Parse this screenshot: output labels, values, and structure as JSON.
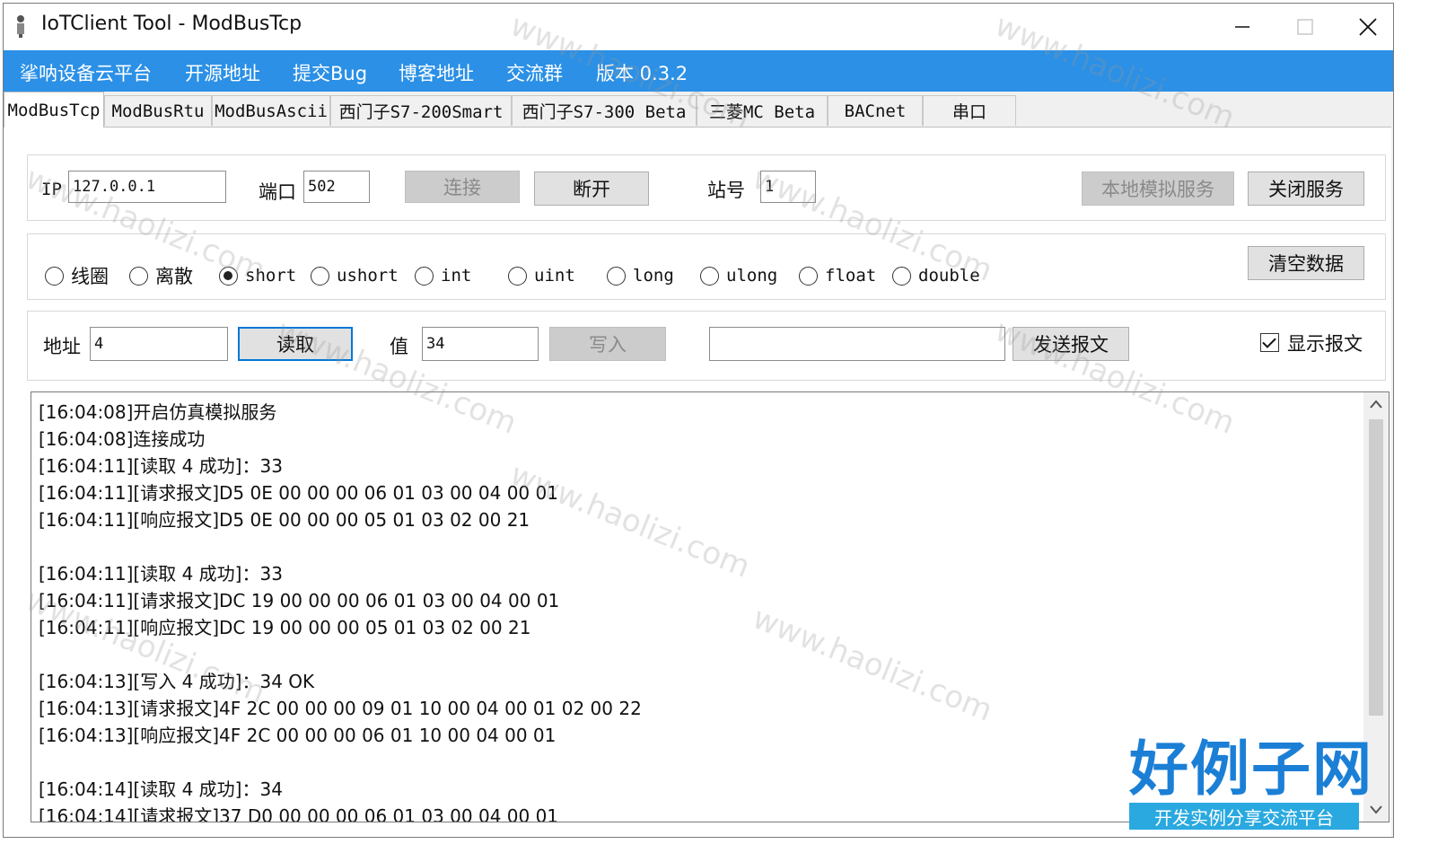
{
  "window": {
    "title": "IoTClient Tool - ModBusTcp"
  },
  "menu": [
    {
      "label": "挲呐设备云平台"
    },
    {
      "label": "开源地址"
    },
    {
      "label": "提交Bug"
    },
    {
      "label": "博客地址"
    },
    {
      "label": "交流群"
    },
    {
      "label": "版本 0.3.2"
    }
  ],
  "tabs": [
    {
      "label": "ModBusTcp"
    },
    {
      "label": "ModBusRtu"
    },
    {
      "label": "ModBusAscii"
    },
    {
      "label": "西门子S7-200Smart"
    },
    {
      "label": "西门子S7-300 Beta"
    },
    {
      "label": "三菱MC Beta"
    },
    {
      "label": "BACnet"
    },
    {
      "label": "串口"
    }
  ],
  "connection": {
    "ip_label": "IP",
    "ip_value": "127.0.0.1",
    "port_label": "端口",
    "port_value": "502",
    "connect_label": "连接",
    "disconnect_label": "断开",
    "station_label": "站号",
    "station_value": "1",
    "local_sim_label": "本地模拟服务",
    "close_service_label": "关闭服务"
  },
  "datatypes": {
    "options": [
      "线圈",
      "离散",
      "short",
      "ushort",
      "int",
      "uint",
      "long",
      "ulong",
      "float",
      "double"
    ],
    "selected": "short",
    "clear_label": "清空数据"
  },
  "io": {
    "address_label": "地址",
    "address_value": "4",
    "read_label": "读取",
    "value_label": "值",
    "value_value": "34",
    "write_label": "写入",
    "message_value": "",
    "send_label": "发送报文",
    "show_message_label": "显示报文",
    "show_message_checked": true
  },
  "log": [
    "[16:04:08]开启仿真模拟服务",
    "[16:04:08]连接成功",
    "[16:04:11][读取 4 成功]：33",
    "[16:04:11][请求报文]D5 0E 00 00 00 06 01 03 00 04 00 01",
    "[16:04:11][响应报文]D5 0E 00 00 00 05 01 03 02 00 21",
    "",
    "[16:04:11][读取 4 成功]：33",
    "[16:04:11][请求报文]DC 19 00 00 00 06 01 03 00 04 00 01",
    "[16:04:11][响应报文]DC 19 00 00 00 05 01 03 02 00 21",
    "",
    "[16:04:13][写入 4 成功]：34 OK",
    "[16:04:13][请求报文]4F 2C 00 00 00 09 01 10 00 04 00 01 02 00 22",
    "[16:04:13][响应报文]4F 2C 00 00 00 06 01 10 00 04 00 01",
    "",
    "[16:04:14][读取 4 成功]：34",
    "[16:04:14][请求报文]37 D0 00 00 00 06 01 03 00 04 00 01"
  ],
  "watermark": "www.haolizi.com",
  "brand": {
    "big": "好例子网",
    "sub": "开发实例分享交流平台"
  },
  "colors": {
    "menubar": "#2b90e6",
    "brand": "#1b7fd6"
  }
}
